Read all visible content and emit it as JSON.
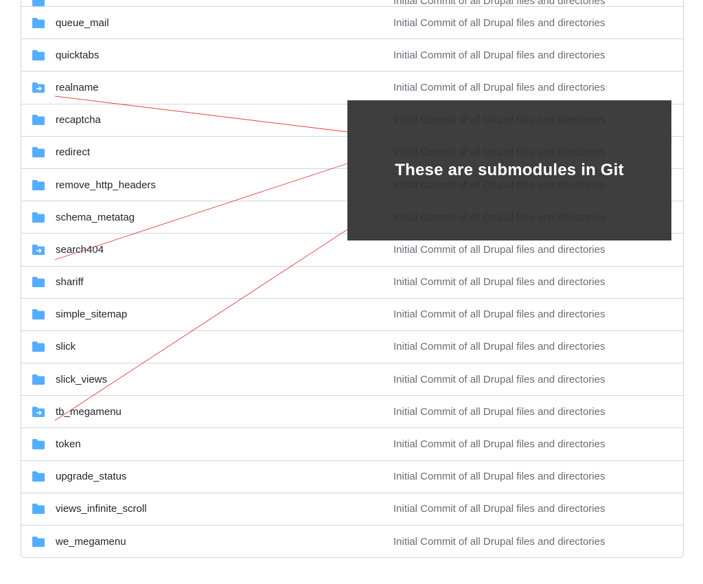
{
  "commit_message": "Initial Commit of all Drupal files and directories",
  "callout": "These are submodules in Git",
  "icon_color": "#54aeff",
  "rows": [
    {
      "name": "",
      "type": "folder",
      "truncated_top": true
    },
    {
      "name": "queue_mail",
      "type": "folder"
    },
    {
      "name": "quicktabs",
      "type": "folder"
    },
    {
      "name": "realname",
      "type": "submodule"
    },
    {
      "name": "recaptcha",
      "type": "folder"
    },
    {
      "name": "redirect",
      "type": "folder"
    },
    {
      "name": "remove_http_headers",
      "type": "folder"
    },
    {
      "name": "schema_metatag",
      "type": "folder"
    },
    {
      "name": "search404",
      "type": "submodule"
    },
    {
      "name": "shariff",
      "type": "folder"
    },
    {
      "name": "simple_sitemap",
      "type": "folder"
    },
    {
      "name": "slick",
      "type": "folder"
    },
    {
      "name": "slick_views",
      "type": "folder"
    },
    {
      "name": "tb_megamenu",
      "type": "submodule"
    },
    {
      "name": "token",
      "type": "folder"
    },
    {
      "name": "upgrade_status",
      "type": "folder"
    },
    {
      "name": "views_infinite_scroll",
      "type": "folder"
    },
    {
      "name": "we_megamenu",
      "type": "folder"
    }
  ]
}
